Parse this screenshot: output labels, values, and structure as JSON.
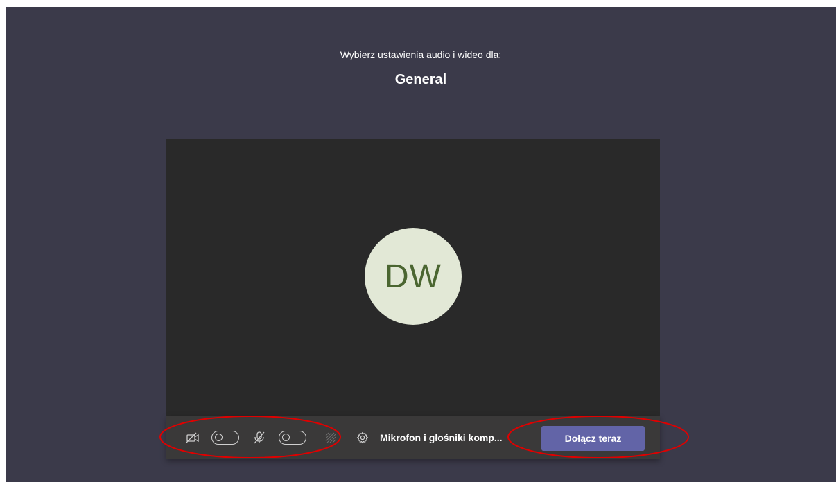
{
  "header": {
    "subtitle": "Wybierz ustawienia audio i wideo dla:",
    "meeting_name": "General"
  },
  "preview": {
    "avatar_initials": "DW",
    "avatar_bg": "#e2e8d6",
    "avatar_fg": "#4b6631"
  },
  "controls": {
    "camera_icon": "camera-off-icon",
    "camera_toggle_state": "off",
    "mic_icon": "mic-off-icon",
    "mic_toggle_state": "off",
    "background_effects_icon": "background-blur-icon",
    "settings_icon": "gear-icon",
    "device_settings_label": "Mikrofon i głośniki komp...",
    "join_label": "Dołącz teraz",
    "accent": "#6264a7"
  },
  "annotations": {
    "color": "#e00000",
    "shape": "ellipse"
  }
}
